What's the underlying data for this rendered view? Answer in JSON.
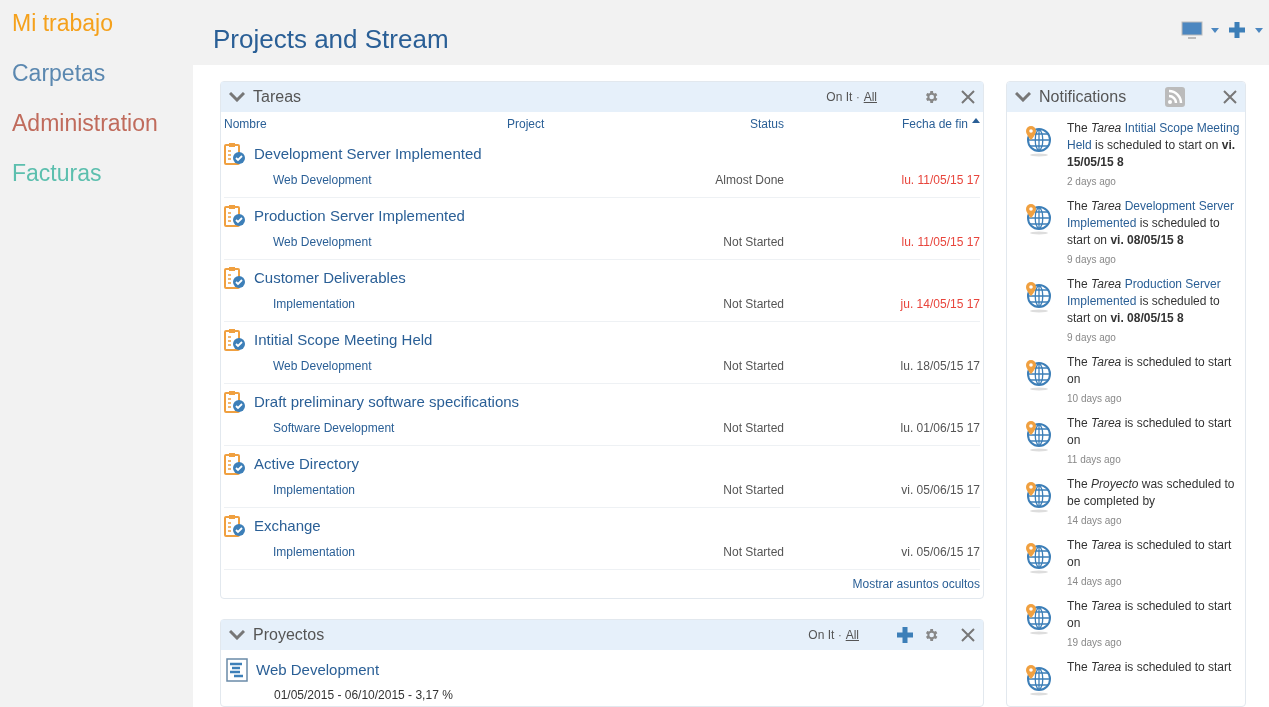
{
  "nav": [
    {
      "label": "Mi trabajo",
      "color": "#f5a11c"
    },
    {
      "label": "Carpetas",
      "color": "#5b88b0"
    },
    {
      "label": "Administration",
      "color": "#c06b5c"
    },
    {
      "label": "Facturas",
      "color": "#5cbfae"
    }
  ],
  "page_title": "Projects and Stream",
  "tasks": {
    "title": "Tareas",
    "separator": "·",
    "filters": [
      {
        "label": "On It",
        "selected": true
      },
      {
        "label": "All",
        "selected": false
      }
    ],
    "columns": [
      {
        "label": "Nombre",
        "sorted": false
      },
      {
        "label": "Project",
        "sorted": false
      },
      {
        "label": "Status",
        "sorted": false
      },
      {
        "label": "Fecha de fin",
        "sorted": true
      }
    ],
    "rows": [
      {
        "name": "Development Server Implemented",
        "project": "Web Development",
        "status": "Almost Done",
        "due": "lu. 11/05/15 17",
        "overdue": true
      },
      {
        "name": "Production Server Implemented",
        "project": "Web Development",
        "status": "Not Started",
        "due": "lu. 11/05/15 17",
        "overdue": true
      },
      {
        "name": "Customer Deliverables",
        "project": "Implementation",
        "status": "Not Started",
        "due": "ju. 14/05/15 17",
        "overdue": true
      },
      {
        "name": "Intitial Scope Meeting Held",
        "project": "Web Development",
        "status": "Not Started",
        "due": "lu. 18/05/15 17",
        "overdue": false
      },
      {
        "name": "Draft preliminary software specifications",
        "project": "Software Development",
        "status": "Not Started",
        "due": "lu. 01/06/15 17",
        "overdue": false
      },
      {
        "name": "Active Directory",
        "project": "Implementation",
        "status": "Not Started",
        "due": "vi. 05/06/15 17",
        "overdue": false
      },
      {
        "name": "Exchange",
        "project": "Implementation",
        "status": "Not Started",
        "due": "vi. 05/06/15 17",
        "overdue": false
      }
    ],
    "footer_link": "Mostrar asuntos ocultos"
  },
  "projects": {
    "title": "Proyectos",
    "separator": "·",
    "filters": [
      {
        "label": "On It",
        "selected": true
      },
      {
        "label": "All",
        "selected": false
      }
    ],
    "rows": [
      {
        "name": "Web Development",
        "details": "01/05/2015 - 06/10/2015 - 3,17 %"
      }
    ]
  },
  "notifications": {
    "title": "Notifications",
    "items": [
      {
        "lead": "The",
        "object": "Tarea",
        "subject": "Intitial Scope Meeting Held",
        "verb": "is scheduled to start on",
        "date": "vi. 15/05/15 8",
        "ago": "2 days ago"
      },
      {
        "lead": "The",
        "object": "Tarea",
        "subject": "Development Server Implemented",
        "verb": "is scheduled to start on",
        "date": "vi. 08/05/15 8",
        "ago": "9 days ago"
      },
      {
        "lead": "The",
        "object": "Tarea",
        "subject": "Production Server Implemented",
        "verb": "is scheduled to start on",
        "date": "vi. 08/05/15 8",
        "ago": "9 days ago"
      },
      {
        "lead": "The",
        "object": "Tarea",
        "verb": "is scheduled to start on",
        "ago": "10 days ago"
      },
      {
        "lead": "The",
        "object": "Tarea",
        "verb": "is scheduled to start on",
        "ago": "11 days ago"
      },
      {
        "lead": "The",
        "object": "Proyecto",
        "verb": "was scheduled to be completed by",
        "ago": "14 days ago"
      },
      {
        "lead": "The",
        "object": "Tarea",
        "verb": "is scheduled to start on",
        "ago": "14 days ago"
      },
      {
        "lead": "The",
        "object": "Tarea",
        "verb": "is scheduled to start on",
        "ago": "19 days ago"
      },
      {
        "lead": "The",
        "object": "Tarea",
        "verb": "is scheduled to start"
      }
    ]
  }
}
